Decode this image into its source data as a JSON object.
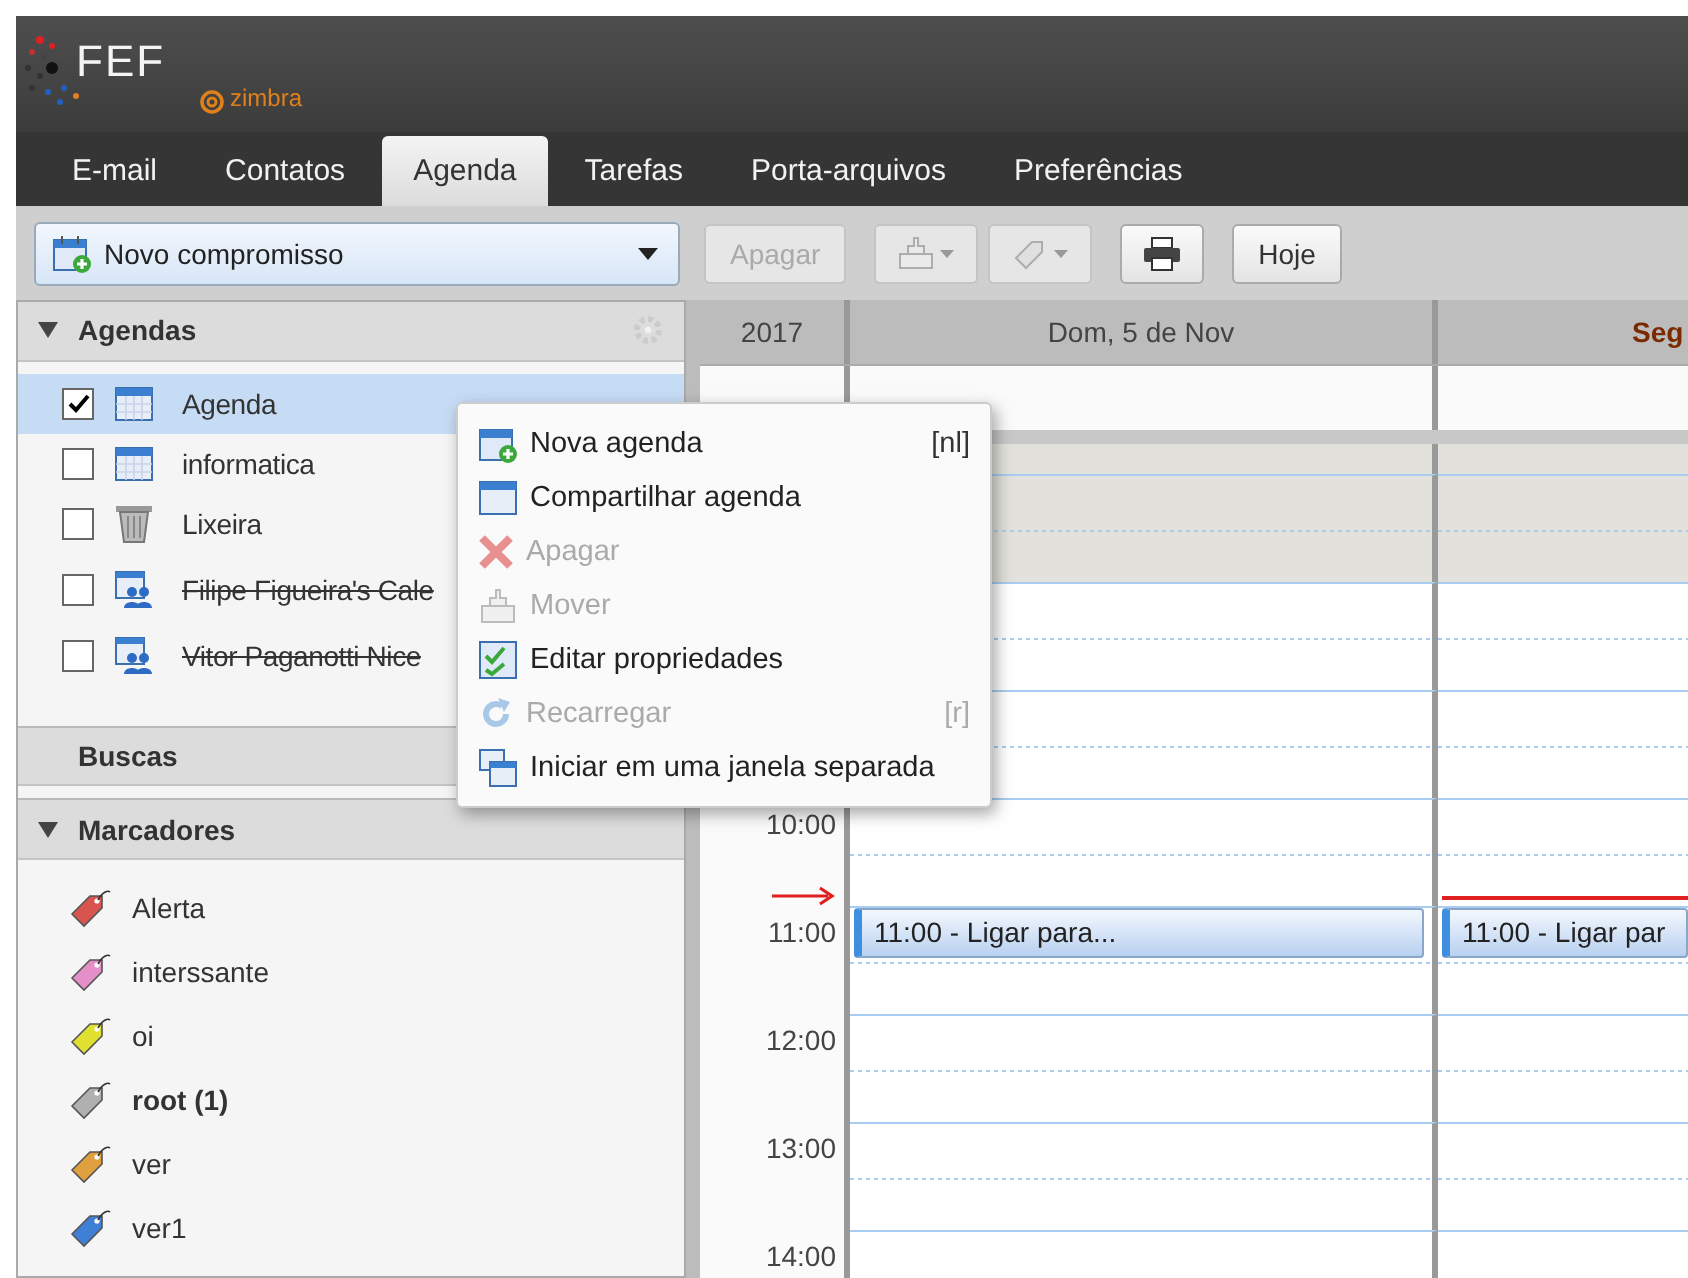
{
  "logo": {
    "text": "FEF",
    "product": "zimbra"
  },
  "tabs": [
    {
      "label": "E-mail",
      "selected": false
    },
    {
      "label": "Contatos",
      "selected": false
    },
    {
      "label": "Agenda",
      "selected": true
    },
    {
      "label": "Tarefas",
      "selected": false
    },
    {
      "label": "Porta-arquivos",
      "selected": false
    },
    {
      "label": "Preferências",
      "selected": false
    }
  ],
  "toolbar": {
    "new_button": "Novo compromisso",
    "delete_button": {
      "label": "Apagar",
      "disabled": true
    },
    "move_disabled": true,
    "tag_disabled": true,
    "today_button": "Hoje"
  },
  "sidebar": {
    "calendars_header": {
      "label": "Agendas",
      "expanded": true
    },
    "calendars": [
      {
        "label": "Agenda",
        "kind": "calendar",
        "checked": true,
        "selected": true,
        "unavailable": false
      },
      {
        "label": "informatica",
        "kind": "calendar",
        "checked": false,
        "selected": false,
        "unavailable": false
      },
      {
        "label": "Lixeira",
        "kind": "trash",
        "checked": false,
        "selected": false,
        "unavailable": false
      },
      {
        "label": "Filipe Figueira's Cale",
        "kind": "shared",
        "checked": false,
        "selected": false,
        "unavailable": true
      },
      {
        "label": "Vitor Paganotti Nice",
        "kind": "shared",
        "checked": false,
        "selected": false,
        "unavailable": true
      }
    ],
    "searches_header": "Buscas",
    "tags_header": {
      "label": "Marcadores",
      "expanded": true
    },
    "tags": [
      {
        "label": "Alerta",
        "color": "#d9534f",
        "unread": false
      },
      {
        "label": "interssante",
        "color": "#e58fc8",
        "unread": false
      },
      {
        "label": "oi",
        "color": "#e0e030",
        "unread": false
      },
      {
        "label": "root (1)",
        "color": "#b0b0b0",
        "unread": true
      },
      {
        "label": "ver",
        "color": "#e0a040",
        "unread": false
      },
      {
        "label": "ver1",
        "color": "#3f7fd6",
        "unread": false
      }
    ]
  },
  "calendar": {
    "year": "2017",
    "days": [
      {
        "label": "Dom, 5 de Nov",
        "today": false
      },
      {
        "label": "Seg",
        "today": true
      }
    ],
    "hours": [
      {
        "off_hours": true
      },
      {
        "off_hours": false
      },
      {
        "off_hours": false
      },
      {
        "label": "10:00",
        "off_hours": false
      },
      {
        "label": "11:00",
        "off_hours": false,
        "now_marker": true,
        "events": [
          {
            "text": "11:00 - Ligar para..."
          },
          {
            "text": "11:00 - Ligar par"
          }
        ]
      },
      {
        "label": "12:00",
        "off_hours": false
      },
      {
        "label": "13:00",
        "off_hours": false
      },
      {
        "label": "14:00",
        "off_hours": false
      }
    ]
  },
  "context_menu": [
    {
      "label": "Nova agenda",
      "kind": "new",
      "disabled": false,
      "shortcut": "[nl]"
    },
    {
      "label": "Compartilhar agenda",
      "kind": "share",
      "disabled": false
    },
    {
      "label": "Apagar",
      "kind": "delete",
      "disabled": true
    },
    {
      "label": "Mover",
      "kind": "move",
      "disabled": true
    },
    {
      "label": "Editar propriedades",
      "kind": "edit",
      "disabled": false
    },
    {
      "label": "Recarregar",
      "kind": "reload",
      "disabled": true,
      "shortcut": "[r]"
    },
    {
      "label": "Iniciar em uma janela separada",
      "kind": "window",
      "disabled": false
    }
  ]
}
